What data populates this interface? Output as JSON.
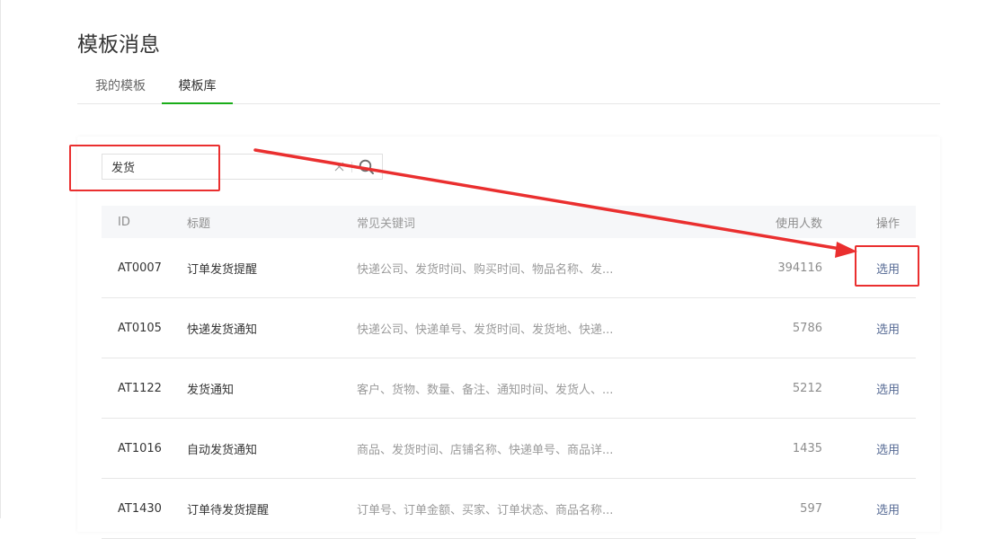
{
  "page": {
    "title": "模板消息"
  },
  "tabs": [
    {
      "label": "我的模板",
      "active": false
    },
    {
      "label": "模板库",
      "active": true
    }
  ],
  "search": {
    "value": "发货",
    "clear_icon": "close-icon",
    "search_icon": "search-icon"
  },
  "table": {
    "headers": {
      "id": "ID",
      "title": "标题",
      "keywords": "常见关键词",
      "count": "使用人数",
      "action": "操作"
    },
    "rows": [
      {
        "id": "AT0007",
        "title": "订单发货提醒",
        "keywords": "快递公司、发货时间、购买时间、物品名称、发...",
        "count": "394116",
        "action": "选用"
      },
      {
        "id": "AT0105",
        "title": "快递发货通知",
        "keywords": "快递公司、快递单号、发货时间、发货地、快递...",
        "count": "5786",
        "action": "选用"
      },
      {
        "id": "AT1122",
        "title": "发货通知",
        "keywords": "客户、货物、数量、备注、通知时间、发货人、...",
        "count": "5212",
        "action": "选用"
      },
      {
        "id": "AT1016",
        "title": "自动发货通知",
        "keywords": "商品、发货时间、店铺名称、快递单号、商品详...",
        "count": "1435",
        "action": "选用"
      },
      {
        "id": "AT1430",
        "title": "订单待发货提醒",
        "keywords": "订单号、订单金额、买家、订单状态、商品名称...",
        "count": "597",
        "action": "选用"
      }
    ]
  },
  "colors": {
    "accent": "#1aad19",
    "link": "#576b95",
    "annotation": "#ea2f2f"
  }
}
